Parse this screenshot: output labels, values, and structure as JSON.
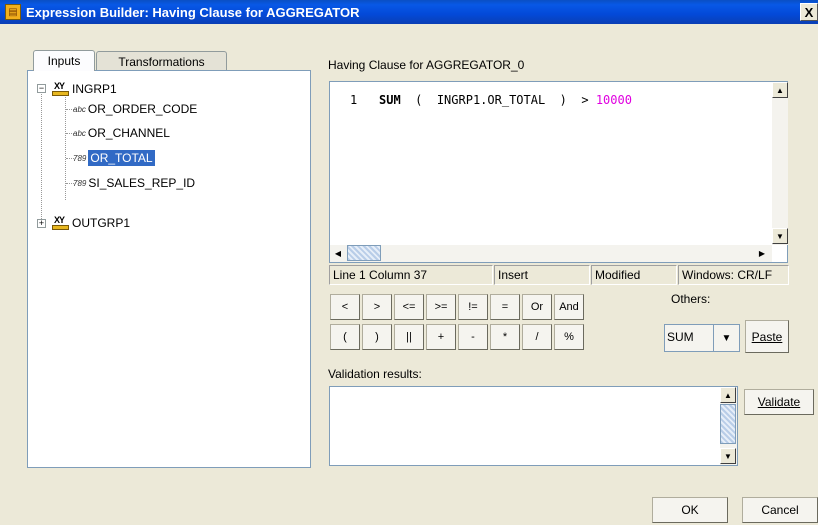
{
  "window": {
    "title": "Expression Builder: Having Clause for AGGREGATOR",
    "close_label": "X",
    "icon": "expression-builder-icon"
  },
  "tabs": [
    {
      "label": "Inputs",
      "active": true
    },
    {
      "label": "Transformations",
      "active": false
    }
  ],
  "tree": {
    "groups": [
      {
        "name": "INGRP1",
        "expanded": true,
        "expander": "−",
        "ports": [
          {
            "type_icon": "abc",
            "name": "OR_ORDER_CODE"
          },
          {
            "type_icon": "abc",
            "name": "OR_CHANNEL"
          },
          {
            "type_icon": "789",
            "name": "OR_TOTAL",
            "selected": true
          },
          {
            "type_icon": "789",
            "name": "SI_SALES_REP_ID"
          }
        ]
      },
      {
        "name": "OUTGRP1",
        "expanded": false,
        "expander": "+"
      }
    ]
  },
  "editor": {
    "label": "Having Clause for AGGREGATOR_0",
    "line_number": "1",
    "tokens": {
      "func": "SUM",
      "lparen": "(",
      "field": "INGRP1.OR_TOTAL",
      "rparen": ")",
      "op": ">",
      "value": "10000"
    },
    "number_color": "#e000e0"
  },
  "status": {
    "position": "Line 1 Column 37",
    "mode": "Insert",
    "modified": "Modified",
    "line_endings": "Windows: CR/LF"
  },
  "operators": {
    "row1": [
      "<",
      ">",
      "<=",
      ">=",
      "!=",
      "=",
      "Or",
      "And"
    ],
    "row2": [
      "(",
      ")",
      "||",
      "+",
      "-",
      "*",
      "/",
      "%"
    ]
  },
  "others": {
    "label": "Others:",
    "selected": "SUM"
  },
  "buttons": {
    "paste": "Paste",
    "validate": "Validate",
    "ok": "OK",
    "cancel": "Cancel"
  },
  "validation": {
    "label": "Validation results:",
    "results": ""
  },
  "colors": {
    "titlebar": "#0a4fc4",
    "selection": "#316ac5",
    "panel_bg": "#ece9d8"
  }
}
